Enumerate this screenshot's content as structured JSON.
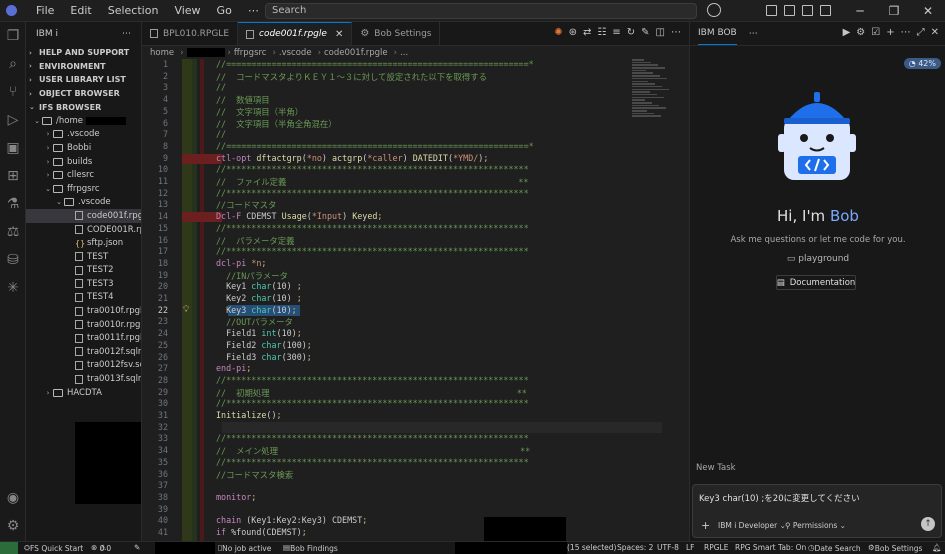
{
  "titlebar": {
    "menu": [
      "File",
      "Edit",
      "Selection",
      "View",
      "Go",
      "⋯"
    ],
    "search_placeholder": "Search"
  },
  "sidebar": {
    "title": "IBM i",
    "sections": [
      "HELP AND SUPPORT",
      "ENVIRONMENT",
      "USER LIBRARY LIST",
      "OBJECT BROWSER",
      "IFS BROWSER"
    ],
    "tree": [
      {
        "label": "/home",
        "indent": 0,
        "kind": "folder",
        "open": true
      },
      {
        "label": ".vscode",
        "indent": 1,
        "kind": "folder",
        "open": false
      },
      {
        "label": "Bobbi",
        "indent": 1,
        "kind": "folder",
        "open": false
      },
      {
        "label": "builds",
        "indent": 1,
        "kind": "folder",
        "open": false
      },
      {
        "label": "cllesrc",
        "indent": 1,
        "kind": "folder",
        "open": false
      },
      {
        "label": "ffrpgsrc",
        "indent": 1,
        "kind": "folder",
        "open": true
      },
      {
        "label": ".vscode",
        "indent": 2,
        "kind": "folder",
        "open": true
      },
      {
        "label": "code001f.rpgle",
        "indent": 3,
        "kind": "file",
        "selected": true
      },
      {
        "label": "CODE001R.rpgle",
        "indent": 3,
        "kind": "file"
      },
      {
        "label": "sftp.json",
        "indent": 3,
        "kind": "json"
      },
      {
        "label": "TEST",
        "indent": 3,
        "kind": "file"
      },
      {
        "label": "TEST2",
        "indent": 3,
        "kind": "file"
      },
      {
        "label": "TEST3",
        "indent": 3,
        "kind": "file"
      },
      {
        "label": "TEST4",
        "indent": 3,
        "kind": "file"
      },
      {
        "label": "tra0010f.rpgle",
        "indent": 3,
        "kind": "file"
      },
      {
        "label": "tra0010r.rpgle",
        "indent": 3,
        "kind": "file"
      },
      {
        "label": "tra0011f.rpgle",
        "indent": 3,
        "kind": "file"
      },
      {
        "label": "tra0012f.sqlrp...",
        "indent": 3,
        "kind": "file"
      },
      {
        "label": "tra0012fsv.sqlr...",
        "indent": 3,
        "kind": "file"
      },
      {
        "label": "tra0013f.sqlrp...",
        "indent": 3,
        "kind": "file"
      },
      {
        "label": "HACDTA",
        "indent": 1,
        "kind": "folder",
        "open": false
      }
    ]
  },
  "editor": {
    "tabs": [
      {
        "label": "BPL010.RPGLE",
        "active": false,
        "icon": "file-icon"
      },
      {
        "label": "code001f.rpgle",
        "active": true,
        "icon": "file-icon"
      },
      {
        "label": "Bob Settings",
        "active": false,
        "icon": "gear-icon"
      }
    ],
    "breadcrumb": [
      "home",
      "ffrpgsrc",
      ".vscode",
      "code001f.rpgle",
      "..."
    ],
    "current_line": 22,
    "lines": [
      {
        "n": 1,
        "t": "//============================================================*"
      },
      {
        "n": 2,
        "t": "//  コードマスタよりＫＥＹ１～３に対して設定された以下を取得する"
      },
      {
        "n": 3,
        "t": "//"
      },
      {
        "n": 4,
        "t": "//  数値項目"
      },
      {
        "n": 5,
        "t": "//  文字項目（半角）"
      },
      {
        "n": 6,
        "t": "//  文字項目（半角全角混在）"
      },
      {
        "n": 7,
        "t": "//"
      },
      {
        "n": 8,
        "t": "//============================================================*"
      },
      {
        "n": 9,
        "t": "ctl-opt dftactgrp(*no) actgrp(*caller) DATEDIT(*YMD/);"
      },
      {
        "n": 10,
        "t": "//************************************************************"
      },
      {
        "n": 11,
        "t": "//  ファイル定義                                              **"
      },
      {
        "n": 12,
        "t": "//************************************************************"
      },
      {
        "n": 13,
        "t": "//コードマスタ"
      },
      {
        "n": 14,
        "t": "Dcl-F CDEMST Usage(*Input) Keyed;"
      },
      {
        "n": 15,
        "t": "//************************************************************"
      },
      {
        "n": 16,
        "t": "//  パラメータ定義"
      },
      {
        "n": 17,
        "t": "//************************************************************"
      },
      {
        "n": 18,
        "t": "dcl-pi *n;"
      },
      {
        "n": 19,
        "t": "  //INパラメータ"
      },
      {
        "n": 20,
        "t": "  Key1 char(10) ;"
      },
      {
        "n": 21,
        "t": "  Key2 char(10) ;"
      },
      {
        "n": 22,
        "t": "  Key3 char(10);"
      },
      {
        "n": 23,
        "t": "  //OUTパラメータ"
      },
      {
        "n": 24,
        "t": "  Field1 int(10);"
      },
      {
        "n": 25,
        "t": "  Field2 char(100);"
      },
      {
        "n": 26,
        "t": "  Field3 char(300);"
      },
      {
        "n": 27,
        "t": "end-pi;"
      },
      {
        "n": 28,
        "t": "//************************************************************"
      },
      {
        "n": 29,
        "t": "//  初期処理                                                 **"
      },
      {
        "n": 30,
        "t": "//************************************************************"
      },
      {
        "n": 31,
        "t": "Initialize();"
      },
      {
        "n": 32,
        "t": ""
      },
      {
        "n": 33,
        "t": "//************************************************************"
      },
      {
        "n": 34,
        "t": "//  メイン処理                                                **"
      },
      {
        "n": 35,
        "t": "//************************************************************"
      },
      {
        "n": 36,
        "t": "//コードマスタ検索"
      },
      {
        "n": 37,
        "t": ""
      },
      {
        "n": 38,
        "t": "monitor;"
      },
      {
        "n": 39,
        "t": ""
      },
      {
        "n": 40,
        "t": "chain (Key1:Key2:Key3) CDEMST;"
      },
      {
        "n": 41,
        "t": "if %found(CDEMST);"
      }
    ]
  },
  "bob": {
    "title": "IBM BOB",
    "usage": "42%",
    "greeting_prefix": "Hi, I'm ",
    "greeting_name": "Bob",
    "subtitle": "Ask me questions or let me code for you.",
    "playground": "playground",
    "documentation": "Documentation",
    "new_task": "New Task",
    "input_value": "Key3 char(10) ;を20に変更してください",
    "mode": "IBM i Developer",
    "permissions": "Permissions"
  },
  "statusbar": {
    "quickstart": "FS Quick Start",
    "errors": "0",
    "warnings": "0",
    "job": "No job active",
    "findings": "Bob Findings",
    "selection": "(15 selected)",
    "spaces": "Spaces: 2",
    "encoding": "UTF-8",
    "eol": "LF",
    "language": "RPGLE",
    "smarttab": "RPG Smart Tab: On",
    "datesearch": "Date Search",
    "bobsettings": "Bob Settings"
  }
}
